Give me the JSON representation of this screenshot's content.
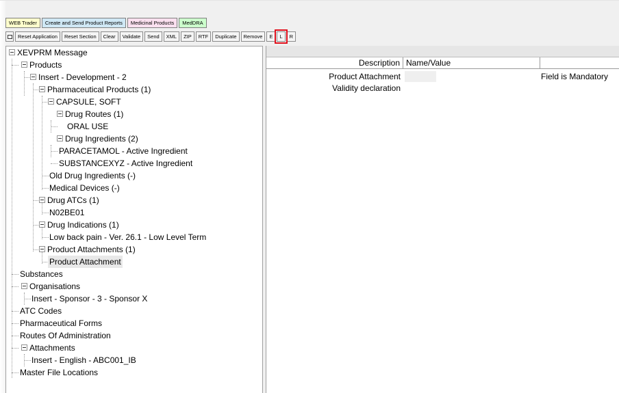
{
  "module_tabs": [
    {
      "label": "WEB Trader",
      "color": "#ffffcc"
    },
    {
      "label": "Create and Send Product Reports",
      "color": "#cfe8f5"
    },
    {
      "label": "Medicinal Products",
      "color": "#fbe0ef"
    },
    {
      "label": "MedDRA",
      "color": "#ccffcc"
    }
  ],
  "toolbar": {
    "icon_name": "window-icon",
    "buttons": [
      "Reset Application",
      "Reset Section",
      "Clear",
      "Validate",
      "Send",
      "XML",
      "ZIP",
      "RTF",
      "Duplicate",
      "Remove",
      "E",
      "L",
      "R"
    ],
    "highlighted": "L",
    "highlight_color": "#e0101c"
  },
  "tree": {
    "nodes": [
      {
        "label": "XEVPRM Message"
      },
      {
        "label": "Products"
      },
      {
        "label": "Insert - Development - 2"
      },
      {
        "label": "Pharmaceutical Products (1)"
      },
      {
        "label": "CAPSULE, SOFT"
      },
      {
        "label": "Drug Routes (1)"
      },
      {
        "label": "ORAL USE"
      },
      {
        "label": "Drug Ingredients (2)"
      },
      {
        "label": "PARACETAMOL - Active Ingredient"
      },
      {
        "label": "SUBSTANCEXYZ - Active Ingredient"
      },
      {
        "label": "Old Drug Ingredients (-)"
      },
      {
        "label": "Medical Devices (-)"
      },
      {
        "label": "Drug ATCs (1)"
      },
      {
        "label": "N02BE01"
      },
      {
        "label": "Drug Indications (1)"
      },
      {
        "label": "Low back pain - Ver. 26.1 - Low Level Term"
      },
      {
        "label": "Product Attachments (1)"
      },
      {
        "label": "Product Attachment"
      },
      {
        "label": "Substances"
      },
      {
        "label": "Organisations"
      },
      {
        "label": "Insert - Sponsor - 3 - Sponsor X"
      },
      {
        "label": "ATC Codes"
      },
      {
        "label": "Pharmaceutical Forms"
      },
      {
        "label": "Routes Of Administration"
      },
      {
        "label": "Attachments"
      },
      {
        "label": "Insert - English - ABC001_IB"
      },
      {
        "label": "Master File Locations"
      }
    ],
    "selected": "Product Attachment"
  },
  "grid": {
    "columns": [
      "Description",
      "Name/Value",
      ""
    ],
    "rows": [
      {
        "description": "Product Attachment",
        "value": "",
        "note": "Field is Mandatory"
      },
      {
        "description": "Validity declaration",
        "value": "",
        "note": ""
      }
    ]
  }
}
